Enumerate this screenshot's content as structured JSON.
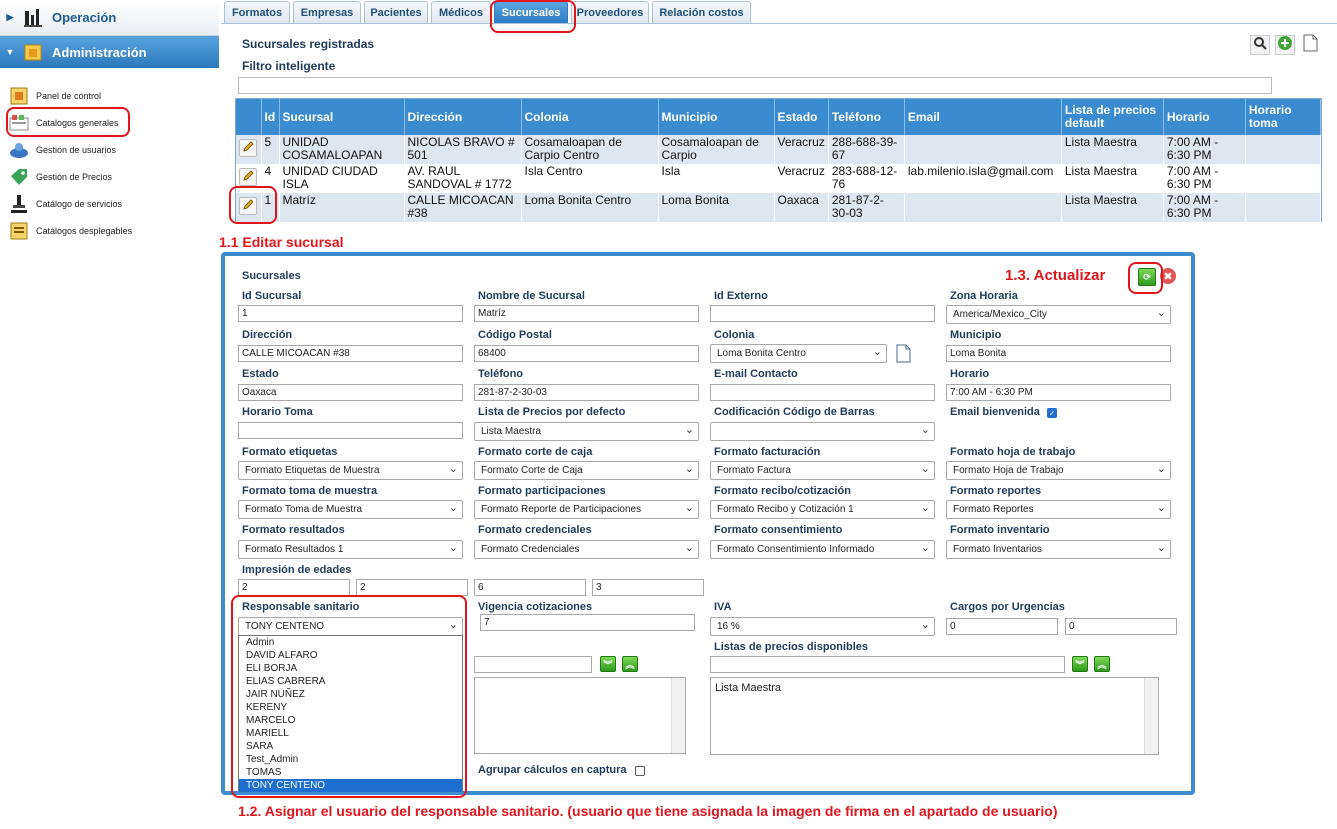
{
  "sidebar": {
    "sections": [
      {
        "label": "Operación",
        "icon": "operation-icon"
      },
      {
        "label": "Administración",
        "icon": "admin-folder-icon"
      }
    ],
    "items": [
      {
        "label": "Panel de control",
        "icon": "control-panel-icon"
      },
      {
        "label": "Catalogos generales",
        "icon": "catalog-icon"
      },
      {
        "label": "Gestión de usuarios",
        "icon": "users-icon"
      },
      {
        "label": "Gestión de Precios",
        "icon": "price-tag-icon"
      },
      {
        "label": "Catálogo de servicios",
        "icon": "services-icon"
      },
      {
        "label": "Catálogos desplegables",
        "icon": "dropdown-catalog-icon"
      }
    ]
  },
  "tabs": [
    {
      "label": "Formatos"
    },
    {
      "label": "Empresas"
    },
    {
      "label": "Pacientes"
    },
    {
      "label": "Médicos"
    },
    {
      "label": "Sucursales",
      "active": true
    },
    {
      "label": "Proveedores"
    },
    {
      "label": "Relación costos"
    }
  ],
  "main": {
    "title": "Sucursales registradas",
    "filter_label": "Filtro inteligente",
    "filter_value": ""
  },
  "table": {
    "columns": [
      "Id",
      "Sucursal",
      "Dirección",
      "Colonia",
      "Municipio",
      "Estado",
      "Teléfono",
      "Email",
      "Lista de precios default",
      "Horario",
      "Horario toma"
    ],
    "rows": [
      [
        "5",
        "UNIDAD COSAMALOAPAN",
        "NICOLAS BRAVO # 501",
        "Cosamaloapan de Carpio Centro",
        "Cosamaloapan de Carpio",
        "Veracruz",
        "288-688-39-67",
        "",
        "Lista Maestra",
        "7:00 AM - 6:30 PM",
        ""
      ],
      [
        "4",
        "UNIDAD CIUDAD ISLA",
        "AV. RAUL SANDOVAL # 1772",
        "Isla Centro",
        "Isla",
        "Veracruz",
        "283-688-12-76",
        "lab.milenio.isla@gmail.com",
        "Lista Maestra",
        "7:00 AM - 6:30 PM",
        ""
      ],
      [
        "1",
        "Matríz",
        "CALLE MICOACAN #38",
        "Loma Bonita Centro",
        "Loma Bonita",
        "Oaxaca",
        "281-87-2-30-03",
        "",
        "Lista Maestra",
        "7:00 AM - 6:30 PM",
        ""
      ]
    ]
  },
  "annotations": {
    "edit": "1.1 Editar sucursal",
    "update": "1.3. Actualizar",
    "assign": "1.2. Asignar el usuario del responsable sanitario. (usuario que tiene asignada la imagen de firma en el apartado de usuario)"
  },
  "form": {
    "title": "Sucursales",
    "fields": {
      "id_sucursal": {
        "label": "Id Sucursal",
        "value": "1"
      },
      "nombre": {
        "label": "Nombre de Sucursal",
        "value": "Matríz"
      },
      "id_externo": {
        "label": "Id Externo",
        "value": ""
      },
      "zona": {
        "label": "Zona Horaria",
        "value": "America/Mexico_City"
      },
      "direccion": {
        "label": "Dirección",
        "value": "CALLE MICOACAN #38"
      },
      "cp": {
        "label": "Código Postal",
        "value": "68400"
      },
      "colonia": {
        "label": "Colonia",
        "value": "Loma Bonita Centro"
      },
      "municipio": {
        "label": "Municipio",
        "value": "Loma Bonita"
      },
      "estado": {
        "label": "Estado",
        "value": "Oaxaca"
      },
      "telefono": {
        "label": "Teléfono",
        "value": "281-87-2-30-03"
      },
      "email": {
        "label": "E-mail Contacto",
        "value": ""
      },
      "horario": {
        "label": "Horario",
        "value": "7:00 AM - 6:30 PM"
      },
      "horario_toma": {
        "label": "Horario Toma",
        "value": ""
      },
      "lista_precios": {
        "label": "Lista de Precios por defecto",
        "value": "Lista Maestra"
      },
      "codificacion": {
        "label": "Codificación Código de Barras",
        "value": ""
      },
      "email_bienvenida": {
        "label": "Email bienvenida",
        "checked": true
      },
      "f_etiquetas": {
        "label": "Formato etiquetas",
        "value": "Formato Etiquetas de Muestra"
      },
      "f_corte": {
        "label": "Formato corte de caja",
        "value": "Formato Corte de Caja"
      },
      "f_facturacion": {
        "label": "Formato facturación",
        "value": "Formato Factura"
      },
      "f_hoja": {
        "label": "Formato hoja de trabajo",
        "value": "Formato Hoja de Trabajo"
      },
      "f_toma": {
        "label": "Formato toma de muestra",
        "value": "Formato Toma de Muestra"
      },
      "f_participaciones": {
        "label": "Formato participaciones",
        "value": "Formato Reporte de Participaciones"
      },
      "f_recibo": {
        "label": "Formato recibo/cotización",
        "value": "Formato Recibo y Cotización 1"
      },
      "f_reportes": {
        "label": "Formato reportes",
        "value": "Formato Reportes"
      },
      "f_resultados": {
        "label": "Formato resultados",
        "value": "Formato Resultados 1"
      },
      "f_credenciales": {
        "label": "Formato credenciales",
        "value": "Formato Credenciales"
      },
      "f_consentimiento": {
        "label": "Formato consentimiento",
        "value": "Formato Consentimiento Informado"
      },
      "f_inventario": {
        "label": "Formato inventario",
        "value": "Formato Inventarios"
      },
      "edades": {
        "label": "Impresión de edades",
        "values": [
          "2",
          "2",
          "6",
          "3"
        ]
      },
      "responsable": {
        "label": "Responsable sanitario",
        "value": "TONY CENTENO"
      },
      "vigencia": {
        "label": "Vigencia cotizaciones",
        "value": "7"
      },
      "iva": {
        "label": "IVA",
        "value": "16 %"
      },
      "urgencias": {
        "label": "Cargos por Urgencias",
        "values": [
          "0",
          "0"
        ]
      },
      "listas_disponibles": {
        "label": "Listas de precios disponibles",
        "value": "",
        "items": [
          "Lista Maestra"
        ]
      },
      "agrupar": {
        "label": "Agrupar cálculos en captura",
        "checked": false
      }
    },
    "responsable_options": [
      "Admin",
      "DAVID ALFARO",
      "ELI BORJA",
      "ELIAS CABRERA",
      "JAIR NUÑEZ",
      "KERENY",
      "MARCELO",
      "MARIELL",
      "SARA",
      "Test_Admin",
      "TOMAS",
      "TONY CENTENO"
    ]
  },
  "colors": {
    "accent": "#3b8bd0",
    "annotation": "#e0161d",
    "green": "#2f9a1f"
  }
}
